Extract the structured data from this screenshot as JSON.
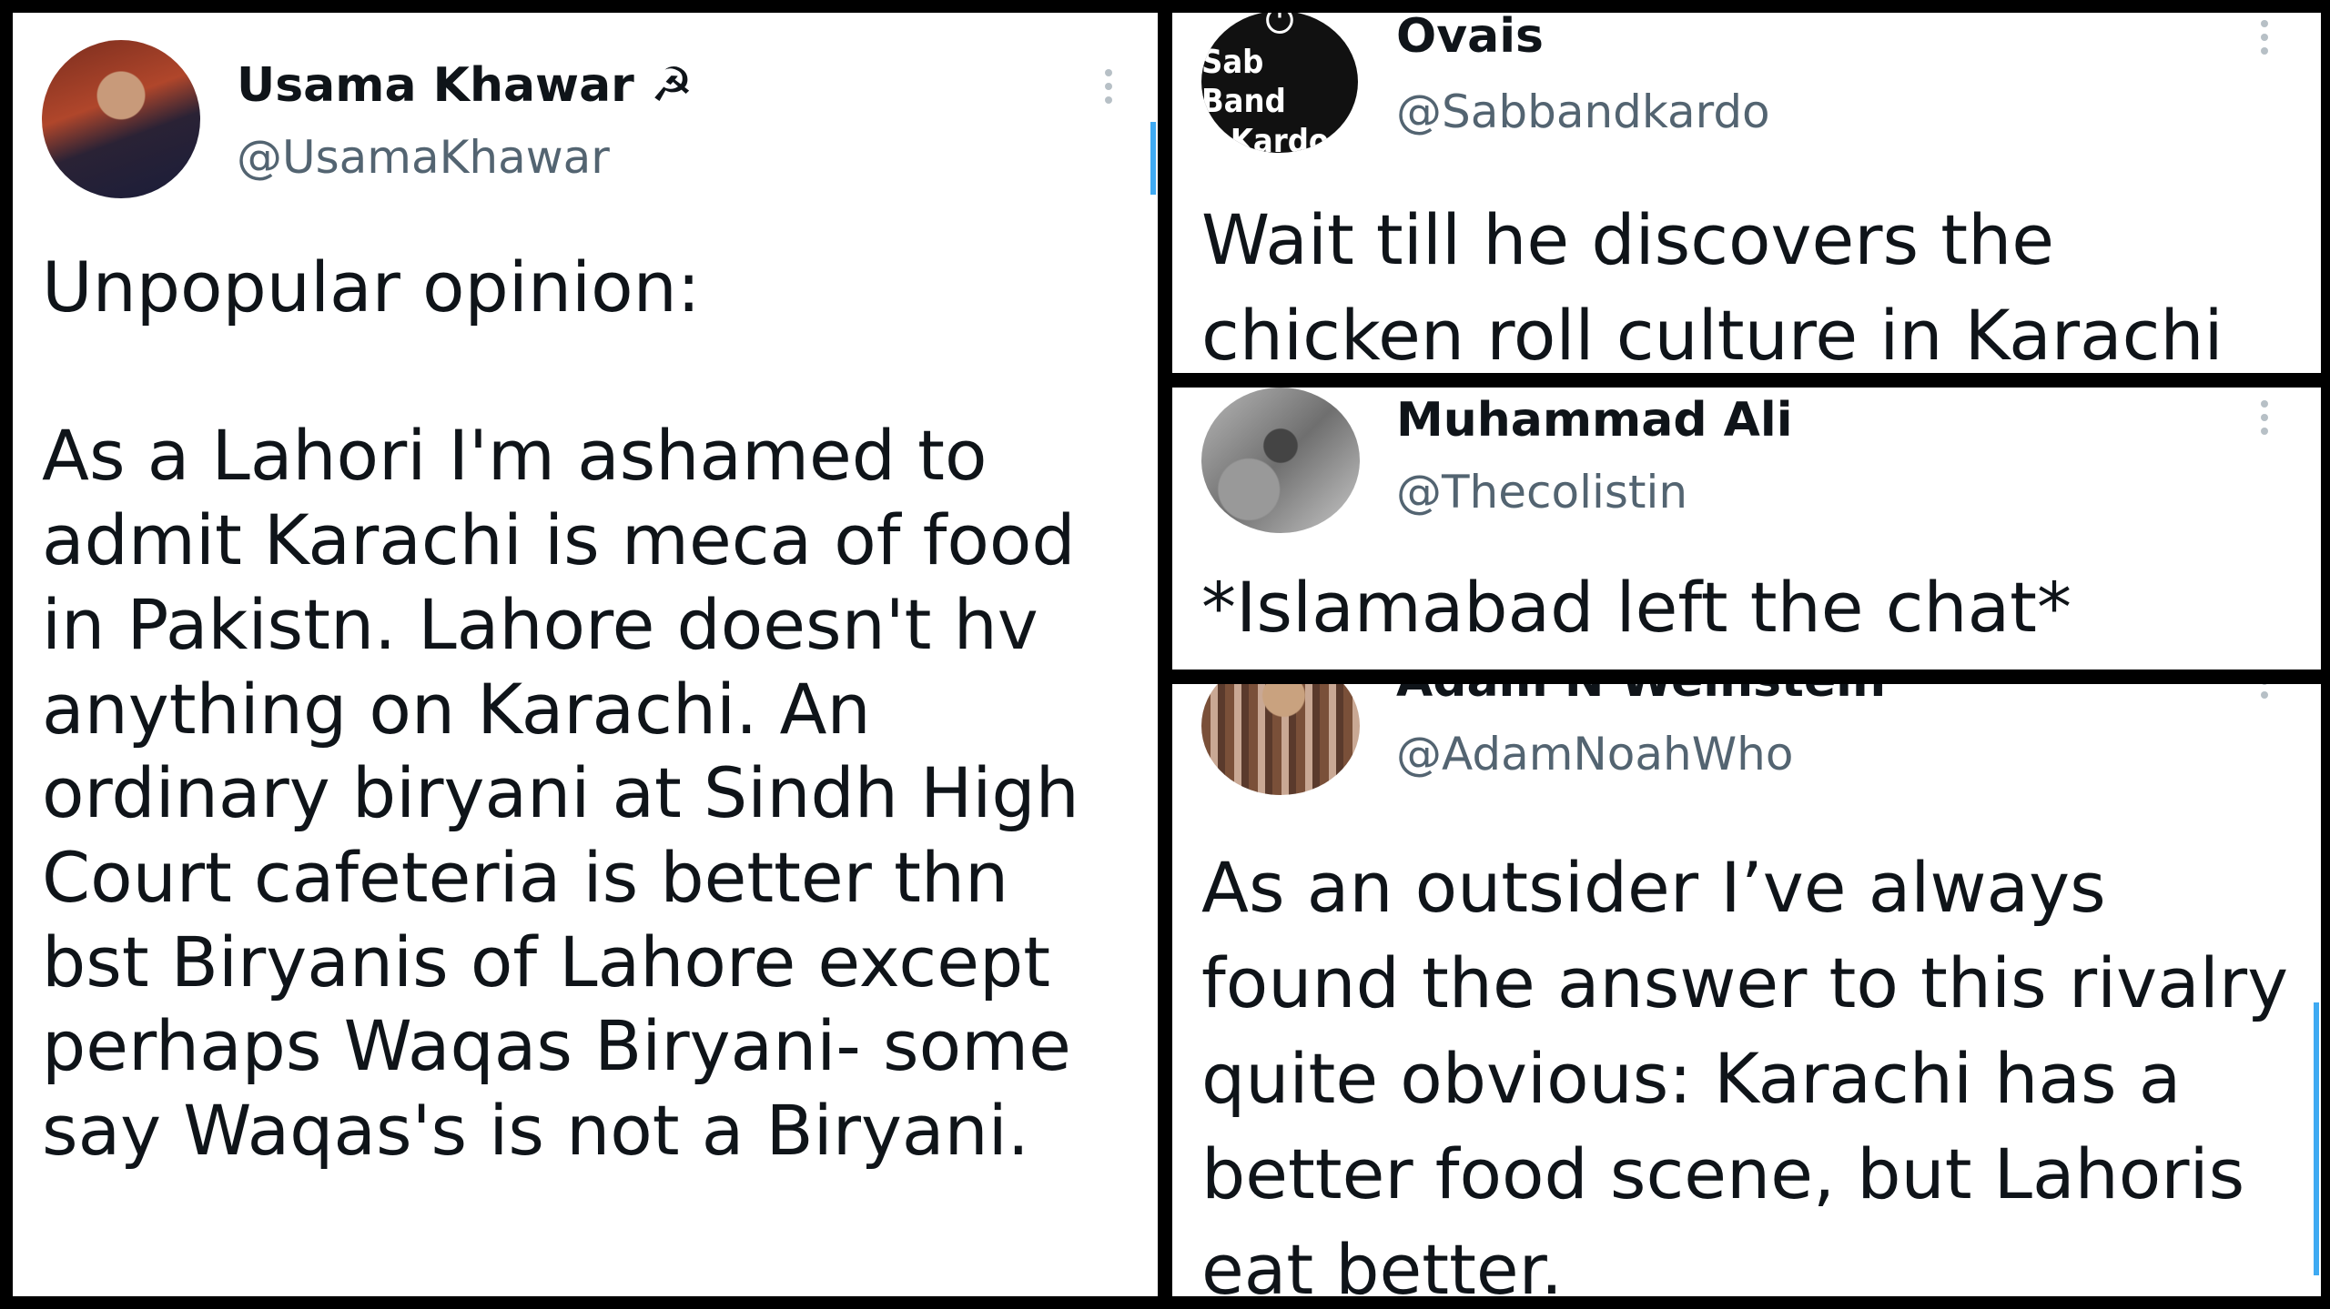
{
  "tweets": [
    {
      "name": "Usama Khawar ☭",
      "handle": "@UsamaKhawar",
      "text": "Unpopular opinion:\n\nAs a Lahori I'm ashamed to admit Karachi is meca of food in Pakistn. Lahore doesn't hv anything on Karachi. An ordinary biryani at Sindh High Court cafeteria is better thn bst Biryanis of Lahore except perhaps Waqas Biryani- some say Waqas's is not a Biryani.",
      "more_icon": "more-vertical-icon"
    },
    {
      "name": "Ovais",
      "handle": "@Sabbandkardo",
      "avatar_text": {
        "icon": "⏻",
        "line1": "Sab Band",
        "line2": "Kardo"
      },
      "text": "Wait till he discovers the chicken roll culture in Karachi",
      "more_icon": "more-vertical-icon"
    },
    {
      "name": "Muhammad Ali",
      "handle": "@Thecolistin",
      "text": "*Islamabad left the chat*",
      "more_icon": "more-vertical-icon"
    },
    {
      "name": "Adam N Weinstein",
      "handle": "@AdamNoahWho",
      "text": "As an outsider I’ve always found the answer to this rivalry quite obvious: Karachi has a better food scene, but Lahoris eat better.",
      "more_icon": "more-vertical-icon"
    }
  ],
  "colors": {
    "background": "#000000",
    "card": "#ffffff",
    "text": "#0f1419",
    "secondary_text": "#536471",
    "accent": "#1d9bf0"
  }
}
